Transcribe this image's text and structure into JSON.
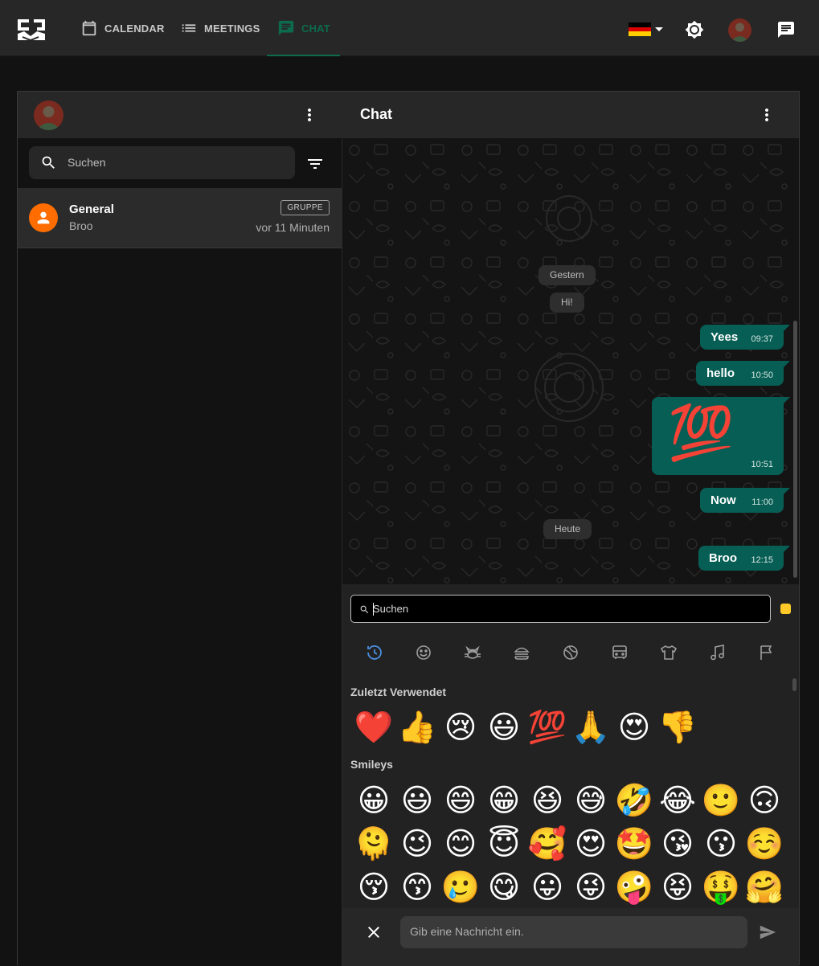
{
  "nav": {
    "calendar": "CALENDAR",
    "meetings": "MEETINGS",
    "chat": "CHAT"
  },
  "colors": {
    "accent": "#0c6b4c",
    "bubble": "#075e54",
    "group_avatar": "#ff6d00",
    "topbar": "#272727",
    "background": "#121212"
  },
  "left": {
    "search_placeholder": "Suchen",
    "chats": [
      {
        "name": "General",
        "last_message": "Broo",
        "badge": "GRUPPE",
        "time": "vor 11 Minuten"
      }
    ]
  },
  "right": {
    "title": "Chat",
    "messages": [
      {
        "type": "date",
        "text": "Gestern"
      },
      {
        "type": "date",
        "text": "Hi!"
      },
      {
        "type": "msg",
        "text": "Yees",
        "time": "09:37"
      },
      {
        "type": "msg",
        "text": "hello",
        "time": "10:50"
      },
      {
        "type": "msg",
        "text": "💯",
        "time": "10:51"
      },
      {
        "type": "msg",
        "text": "Now",
        "time": "11:00"
      },
      {
        "type": "date",
        "text": "Heute"
      },
      {
        "type": "msg",
        "text": "Broo",
        "time": "12:15"
      }
    ]
  },
  "emoji_picker": {
    "search_placeholder": "Suchen",
    "categories": [
      "clock-icon",
      "smiley-icon",
      "cat-icon",
      "burger-icon",
      "ball-icon",
      "bus-icon",
      "shirt-icon",
      "music-icon",
      "flag-icon"
    ],
    "recent_title": "Zuletzt Verwendet",
    "recent": [
      "❤️",
      "👍",
      "😢",
      "😃",
      "💯",
      "🙏",
      "😍",
      "👎"
    ],
    "smileys_title": "Smileys",
    "smileys_rows": [
      [
        "😀",
        "😃",
        "😄",
        "😁",
        "😆",
        "😅",
        "🤣",
        "😂",
        "🙂",
        "🙃"
      ],
      [
        "🫠",
        "😉",
        "😊",
        "😇",
        "🥰",
        "😍",
        "🤩",
        "😘",
        "😗",
        "☺️"
      ],
      [
        "😚",
        "😙",
        "🥲",
        "😋",
        "😛",
        "😜",
        "🤪",
        "😝",
        "🤑",
        "🤗"
      ]
    ]
  },
  "composer": {
    "placeholder": "Gib eine Nachricht ein."
  }
}
